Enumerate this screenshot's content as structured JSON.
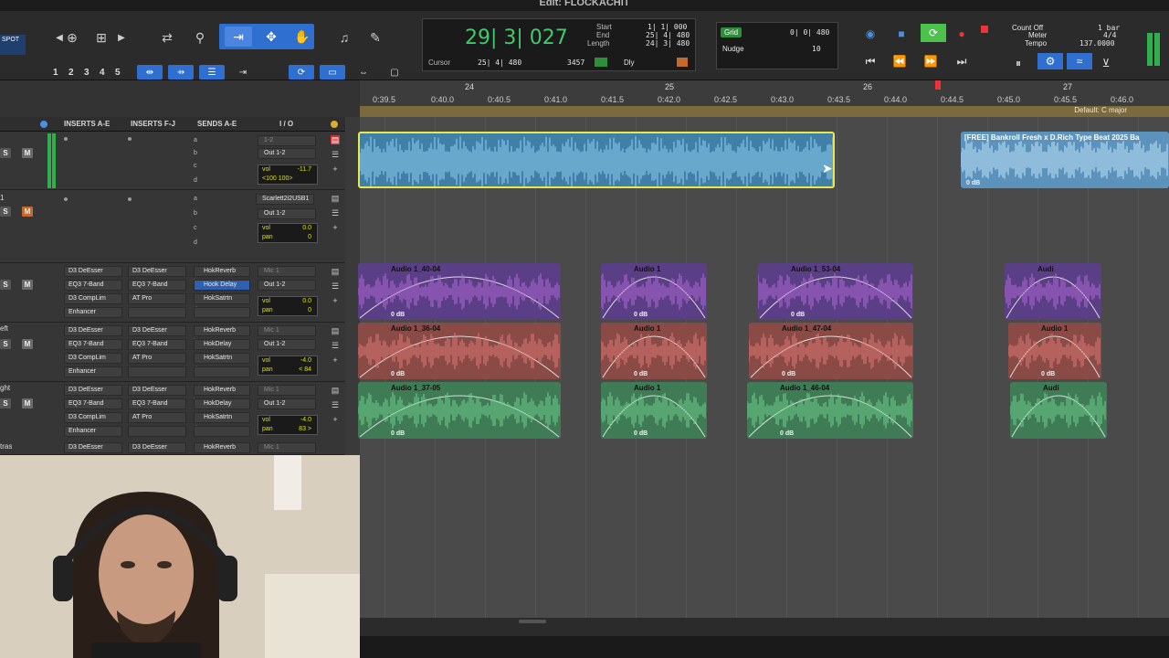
{
  "window": {
    "title": "Edit: FLOCKACHIT"
  },
  "toolbar": {
    "left_badge": "SPOT",
    "number_buttons": [
      "1",
      "2",
      "3",
      "4",
      "5"
    ],
    "icons": [
      "zoom-in-icon",
      "trim-icon",
      "selector-icon",
      "grabber-icon",
      "hand-icon",
      "speaker-icon",
      "pencil-icon",
      "magnifier-icon",
      "cursor-icon",
      "shuffle-icon"
    ]
  },
  "counter": {
    "main": "29| 3| 027",
    "start_label": "Start",
    "end_label": "End",
    "length_label": "Length",
    "start": "1| 1| 000",
    "end": "25| 4| 480",
    "length": "24| 3| 480",
    "cursor_label": "Cursor",
    "cursor": "25| 4| 480",
    "cursor_extra": "3457",
    "dly_label": "Dly"
  },
  "grid": {
    "label": "Grid",
    "value": "0| 0| 480",
    "nudge_label": "Nudge",
    "nudge_value": "10"
  },
  "count": {
    "count_off": "Count Off",
    "meter_label": "Meter",
    "tempo_label": "Tempo",
    "bars": "1 bar",
    "meter": "4/4",
    "tempo": "137.0000"
  },
  "ruler": {
    "bars": [
      {
        "label": "24"
      },
      {
        "label": "25"
      },
      {
        "label": "26"
      },
      {
        "label": "27"
      }
    ],
    "times": [
      "0:39.5",
      "0:40.0",
      "0:40.5",
      "0:41.0",
      "0:41.5",
      "0:42.0",
      "0:42.5",
      "0:43.0",
      "0:43.5",
      "0:44.0",
      "0:44.5",
      "0:45.0",
      "0:45.5",
      "0:46.0"
    ],
    "key_label": "Default: C major"
  },
  "columns": {
    "inserts_ae": "INSERTS A-E",
    "inserts_fj": "INSERTS F-J",
    "sends_ae": "SENDS A-E",
    "io": "I / O"
  },
  "tracks": [
    {
      "name": "",
      "inserts": [
        "",
        "",
        "",
        "",
        ""
      ],
      "inserts2": [
        "",
        "",
        "",
        "",
        ""
      ],
      "sends": [
        {
          "l": "a",
          "v": ""
        },
        {
          "l": "b",
          "v": ""
        },
        {
          "l": "c",
          "v": ""
        },
        {
          "l": "d",
          "v": ""
        }
      ],
      "io_in": "1-2",
      "io_out": "Out 1-2",
      "vol": "-11.7",
      "pan": "<100   100>"
    },
    {
      "name": "1",
      "inserts": [
        "",
        "",
        "",
        "",
        ""
      ],
      "inserts2": [
        "",
        "",
        "",
        "",
        ""
      ],
      "sends": [
        {
          "l": "a",
          "v": ""
        },
        {
          "l": "b",
          "v": ""
        },
        {
          "l": "c",
          "v": ""
        },
        {
          "l": "d",
          "v": ""
        }
      ],
      "io_in": "Scarlett2i2USB1",
      "io_out": "Out 1-2",
      "vol": "0.0",
      "pan": "0"
    },
    {
      "name": "",
      "inserts": [
        "D3 DeEsser",
        "EQ3 7-Band",
        "D3 CompLim",
        "Enhancer"
      ],
      "inserts2": [
        "D3 DeEsser",
        "EQ3 7-Band",
        "AT Pro",
        ""
      ],
      "sends": [
        {
          "l": "a",
          "v": "HokReverb"
        },
        {
          "l": "b",
          "v": "Hook Delay"
        },
        {
          "l": "c",
          "v": "HokSatrtn"
        },
        {
          "l": "d",
          "v": ""
        }
      ],
      "io_in": "Mic 1",
      "io_out": "Out 1-2",
      "vol": "0.0",
      "pan": "0"
    },
    {
      "name": "eft",
      "inserts": [
        "D3 DeEsser",
        "EQ3 7-Band",
        "D3 CompLim",
        "Enhancer"
      ],
      "inserts2": [
        "D3 DeEsser",
        "EQ3 7-Band",
        "AT Pro",
        ""
      ],
      "sends": [
        {
          "l": "a",
          "v": "HokReverb"
        },
        {
          "l": "b",
          "v": "HokDelay"
        },
        {
          "l": "c",
          "v": "HokSatrtn"
        },
        {
          "l": "d",
          "v": ""
        }
      ],
      "io_in": "Mic 1",
      "io_out": "Out 1-2",
      "vol": "-4.0",
      "pan": "< 84"
    },
    {
      "name": "ght",
      "inserts": [
        "D3 DeEsser",
        "EQ3 7-Band",
        "D3 CompLim",
        "Enhancer"
      ],
      "inserts2": [
        "D3 DeEsser",
        "EQ3 7-Band",
        "AT Pro",
        ""
      ],
      "sends": [
        {
          "l": "a",
          "v": "HokReverb"
        },
        {
          "l": "b",
          "v": "HokDelay"
        },
        {
          "l": "c",
          "v": "HokSatrtn"
        },
        {
          "l": "d",
          "v": ""
        }
      ],
      "io_in": "Mic 1",
      "io_out": "Out 1-2",
      "vol": "-4.0",
      "pan": "83 >"
    },
    {
      "name": "tras",
      "inserts": [
        "D3 DeEsser"
      ],
      "inserts2": [
        "D3 DeEsser"
      ],
      "sends": [
        {
          "l": "a",
          "v": "HokReverb"
        }
      ],
      "io_in": "Mic 1",
      "io_out": "",
      "vol": "",
      "pan": ""
    }
  ],
  "clips": {
    "beat_right": {
      "name": "[FREE] Bankroll Fresh x D.Rich Type Beat 2025 Ba",
      "db": "0 dB"
    },
    "purple": [
      {
        "name": "Audio 1_40-04",
        "db": "0 dB"
      },
      {
        "name": "Audio 1",
        "db": "0 dB"
      },
      {
        "name": "Audio 1_53-04",
        "db": "0 dB"
      },
      {
        "name": "Audi",
        "db": ""
      }
    ],
    "red": [
      {
        "name": "Audio 1_36-04",
        "db": "0 dB"
      },
      {
        "name": "Audio 1",
        "db": "0 dB"
      },
      {
        "name": "Audio 1_47-04",
        "db": "0 dB"
      },
      {
        "name": "Audio 1",
        "db": "0 dB"
      }
    ],
    "green": [
      {
        "name": "Audio 1_37-05",
        "db": "0 dB"
      },
      {
        "name": "Audio 1",
        "db": "0 dB"
      },
      {
        "name": "Audio 1_46-04",
        "db": "0 dB"
      },
      {
        "name": "Audi",
        "db": ""
      }
    ]
  },
  "colors": {
    "beat": "#3f7fa8",
    "purple": "#5b3f86",
    "red": "#8a4a45",
    "green": "#3f7c55",
    "selection": "#e8e84a"
  }
}
